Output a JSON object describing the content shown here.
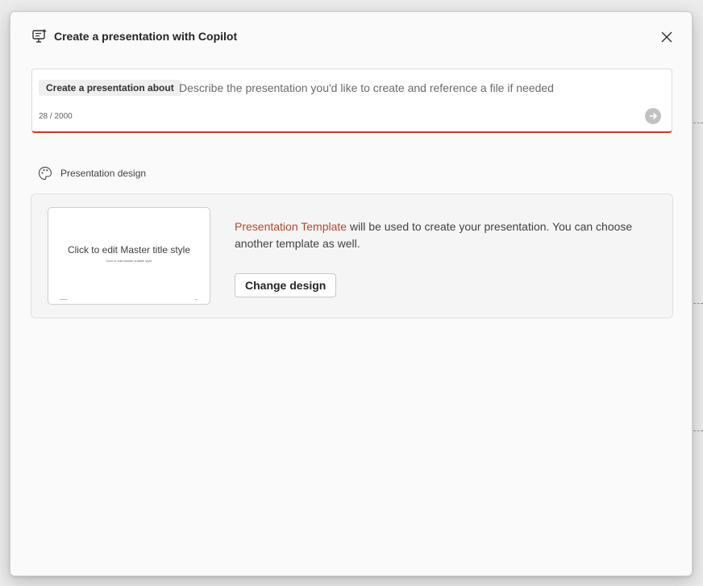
{
  "dialog": {
    "title": "Create a presentation with Copilot",
    "title_icon": "copilot-presentation-icon",
    "close_icon": "close-icon"
  },
  "prompt": {
    "chip_label": "Create a presentation about",
    "placeholder": "Describe the presentation you'd like to create and reference a file if needed",
    "value": "",
    "char_count": "28 / 2000",
    "send_icon": "send-arrow-icon"
  },
  "design_section": {
    "label": "Presentation design",
    "icon": "palette-icon",
    "thumbnail": {
      "title": "Click to edit Master title style",
      "subtitle": "Click to edit Master subtitle style"
    },
    "template_name": "Presentation Template",
    "description": " will be used to create your presentation. You can choose another template as well.",
    "change_button": "Change design"
  },
  "colors": {
    "accent": "#c43e1c",
    "link": "#b7472a",
    "send_disabled": "#c2c2c2"
  }
}
